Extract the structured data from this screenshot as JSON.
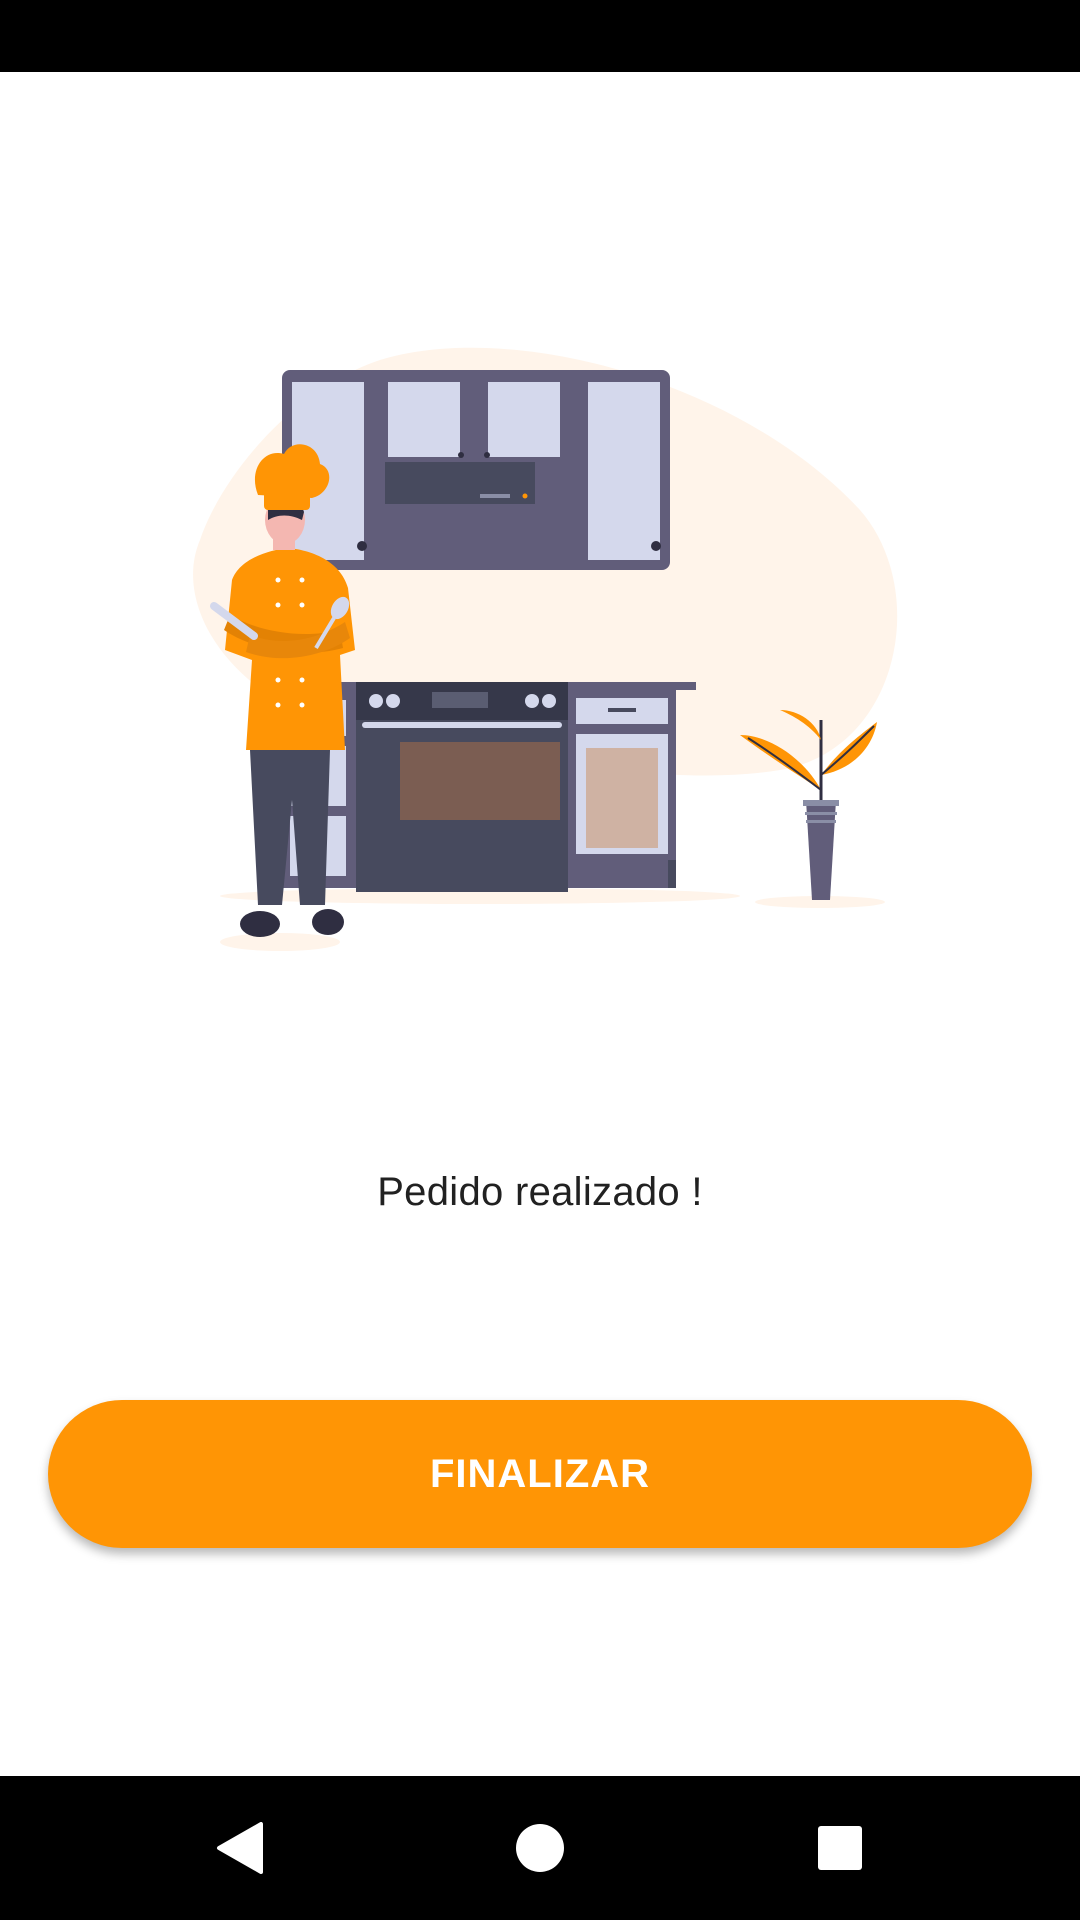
{
  "status_bar": {},
  "illustration": {
    "description_icon": "chef-kitchen-illustration-icon",
    "colors": {
      "accent": "#FF9505",
      "blob": "#FFF4EA",
      "cabinet_frame": "#615D7A",
      "cabinet_panel": "#D4D8EC",
      "stove": "#474A5E",
      "oven_window": "#7B5D52",
      "skin": "#F4B7B1"
    }
  },
  "main": {
    "message": "Pedido realizado !"
  },
  "actions": {
    "finish_label": "FINALIZAR",
    "accent_color": "#FF9505"
  },
  "nav_bar": {
    "back_icon": "back-triangle-icon",
    "home_icon": "home-circle-icon",
    "recents_icon": "recents-square-icon"
  }
}
